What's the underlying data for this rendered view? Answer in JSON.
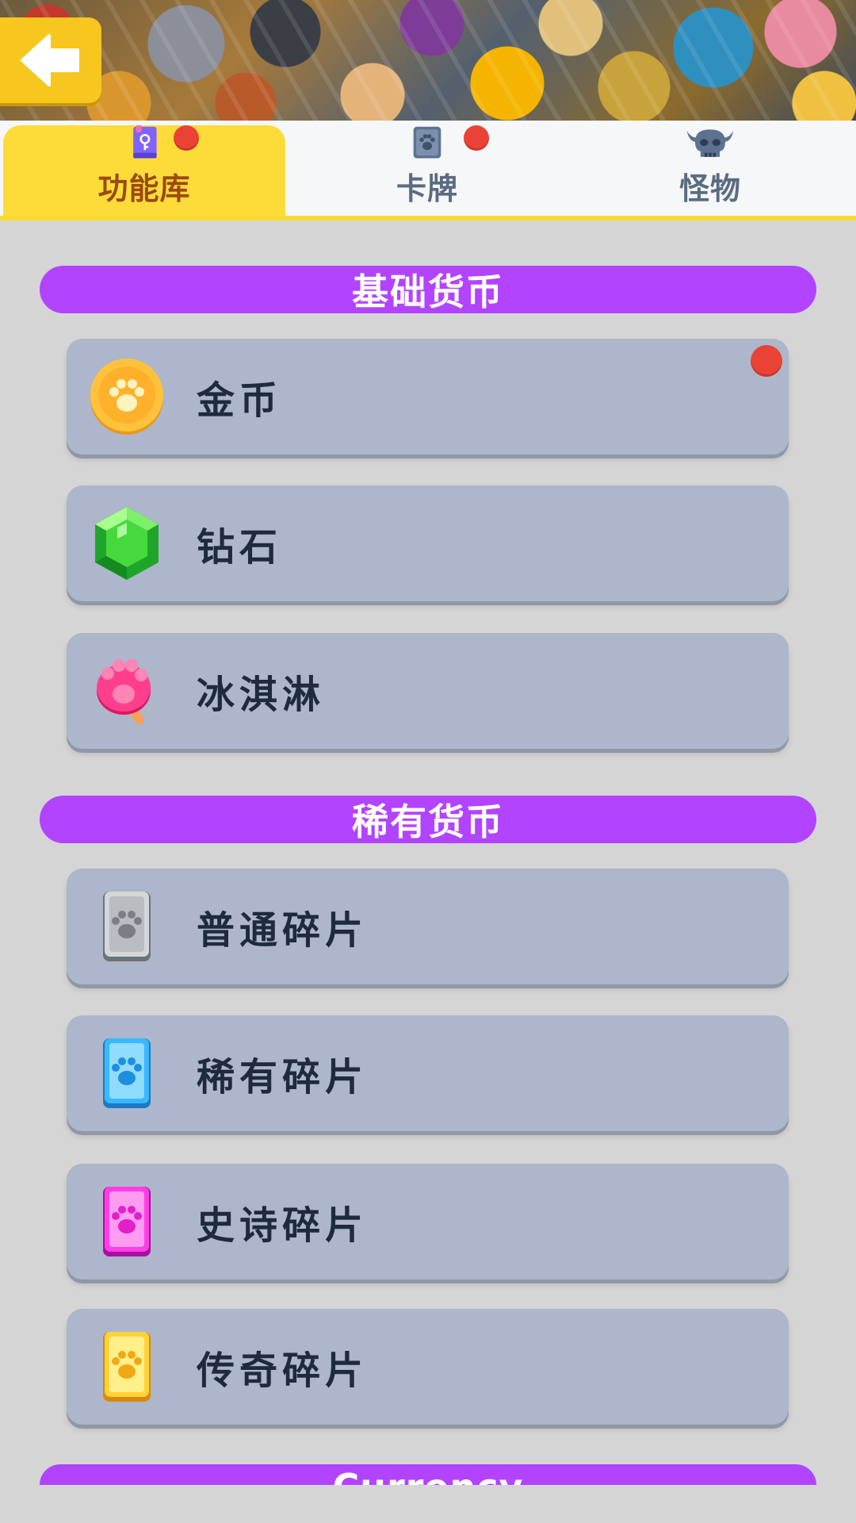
{
  "header": {
    "back_icon": "back-arrow-icon"
  },
  "tabs": [
    {
      "label": "功能库",
      "icon": "book-key-icon",
      "active": true,
      "badge": true
    },
    {
      "label": "卡牌",
      "icon": "paw-card-icon",
      "active": false,
      "badge": true
    },
    {
      "label": "怪物",
      "icon": "horned-skull-icon",
      "active": false,
      "badge": false
    }
  ],
  "sections": {
    "basic": {
      "title": "基础货币",
      "items": [
        {
          "label": "金币",
          "icon": "gold-paw-coin-icon",
          "badge": true
        },
        {
          "label": "钻石",
          "icon": "green-gem-icon",
          "badge": false
        },
        {
          "label": "冰淇淋",
          "icon": "pink-paw-icecream-icon",
          "badge": false
        }
      ]
    },
    "rare": {
      "title": "稀有货币",
      "items": [
        {
          "label": "普通碎片",
          "icon": "gray-card-fragment-icon",
          "badge": false
        },
        {
          "label": "稀有碎片",
          "icon": "blue-card-fragment-icon",
          "badge": false
        },
        {
          "label": "史诗碎片",
          "icon": "purple-card-fragment-icon",
          "badge": false
        },
        {
          "label": "传奇碎片",
          "icon": "gold-card-fragment-icon",
          "badge": false
        }
      ]
    },
    "next": {
      "title": "Currency"
    }
  },
  "colors": {
    "section_header": "#b244ff",
    "row_bg": "#adb6ca",
    "active_tab": "#fddc3a",
    "badge": "#ea4335",
    "back_button": "#f7c61f"
  }
}
